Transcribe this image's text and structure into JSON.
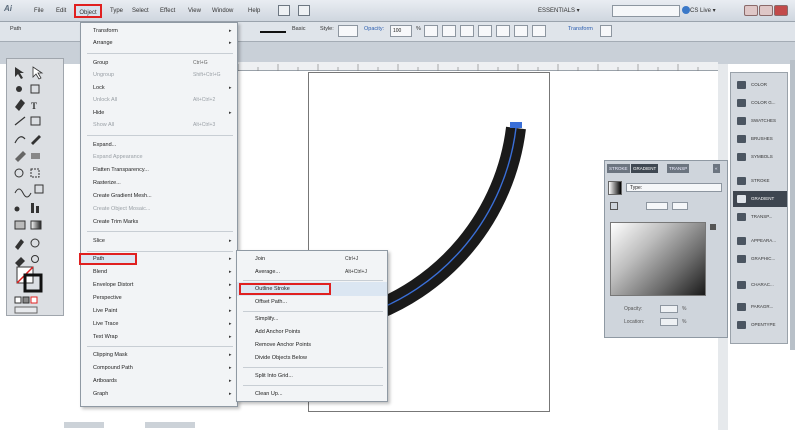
{
  "app": {
    "logo": "Ai",
    "menus": [
      "File",
      "Edit",
      "Object",
      "Type",
      "Select",
      "Effect",
      "View",
      "Window",
      "Help"
    ],
    "active_menu": "Object",
    "workspace": "ESSENTIALS ▾",
    "cs_live": "CS Live ▾"
  },
  "control_bar": {
    "left_label": "Path",
    "basic": "Basic",
    "style": "Style:",
    "opacity_label": "Opacity:",
    "opacity_value": "100",
    "percent": "%",
    "transform": "Transform"
  },
  "object_menu": {
    "items": [
      {
        "label": "Transform",
        "arrow": "▸"
      },
      {
        "label": "Arrange",
        "arrow": "▸"
      },
      {
        "label": "Group",
        "shortcut": "Ctrl+G"
      },
      {
        "label": "Ungroup",
        "shortcut": "Shift+Ctrl+G",
        "disabled": true
      },
      {
        "label": "Lock",
        "arrow": "▸"
      },
      {
        "label": "Unlock All",
        "shortcut": "Alt+Ctrl+2",
        "disabled": true
      },
      {
        "label": "Hide",
        "arrow": "▸"
      },
      {
        "label": "Show All",
        "shortcut": "Alt+Ctrl+3",
        "disabled": true
      },
      {
        "label": "Expand..."
      },
      {
        "label": "Expand Appearance",
        "disabled": true
      },
      {
        "label": "Flatten Transparency..."
      },
      {
        "label": "Rasterize..."
      },
      {
        "label": "Create Gradient Mesh..."
      },
      {
        "label": "Create Object Mosaic...",
        "disabled": true
      },
      {
        "label": "Create Trim Marks"
      },
      {
        "label": "Slice",
        "arrow": "▸"
      },
      {
        "label": "Path",
        "arrow": "▸"
      },
      {
        "label": "Blend",
        "arrow": "▸"
      },
      {
        "label": "Envelope Distort",
        "arrow": "▸"
      },
      {
        "label": "Perspective",
        "arrow": "▸"
      },
      {
        "label": "Live Paint",
        "arrow": "▸"
      },
      {
        "label": "Live Trace",
        "arrow": "▸"
      },
      {
        "label": "Text Wrap",
        "arrow": "▸"
      },
      {
        "label": "Clipping Mask",
        "arrow": "▸"
      },
      {
        "label": "Compound Path",
        "arrow": "▸"
      },
      {
        "label": "Artboards",
        "arrow": "▸"
      },
      {
        "label": "Graph",
        "arrow": "▸"
      }
    ]
  },
  "path_menu": {
    "items": [
      {
        "label": "Join",
        "shortcut": "Ctrl+J"
      },
      {
        "label": "Average...",
        "shortcut": "Alt+Ctrl+J"
      },
      {
        "label": "Outline Stroke"
      },
      {
        "label": "Offset Path..."
      },
      {
        "label": "Simplify..."
      },
      {
        "label": "Add Anchor Points"
      },
      {
        "label": "Remove Anchor Points"
      },
      {
        "label": "Divide Objects Below"
      },
      {
        "label": "Split Into Grid..."
      },
      {
        "label": "Clean Up..."
      }
    ],
    "highlighted": "Outline Stroke"
  },
  "gradient_panel": {
    "tabs": [
      "STROKE",
      "GRADIENT",
      "TRANSP",
      "«"
    ],
    "active_tab": "GRADIENT",
    "type_label": "Type:",
    "opacity_label": "Opacity:",
    "location_label": "Location:",
    "percent": "%"
  },
  "dock": {
    "items": [
      {
        "label": "COLOR",
        "icon": "color-icon"
      },
      {
        "label": "COLOR G...",
        "icon": "color-guide-icon"
      },
      {
        "label": "SWATCHES",
        "icon": "swatches-icon"
      },
      {
        "label": "BRUSHES",
        "icon": "brushes-icon"
      },
      {
        "label": "SYMBOLS",
        "icon": "symbols-icon"
      },
      {
        "label": "STROKE",
        "icon": "stroke-icon"
      },
      {
        "label": "GRADIENT",
        "icon": "gradient-icon",
        "active": true
      },
      {
        "label": "TRANSP...",
        "icon": "transparency-icon"
      },
      {
        "label": "APPEARA...",
        "icon": "appearance-icon"
      },
      {
        "label": "GRAPHIC...",
        "icon": "graphic-styles-icon"
      },
      {
        "label": "CHARAC...",
        "icon": "character-icon"
      },
      {
        "label": "PARAGR...",
        "icon": "paragraph-icon"
      },
      {
        "label": "OPENTYPE",
        "icon": "opentype-icon"
      }
    ]
  },
  "colors": {
    "highlight_box": "#e02020",
    "arc_stroke": "#1a1a1a",
    "arc_path": "#3a6fd8"
  }
}
